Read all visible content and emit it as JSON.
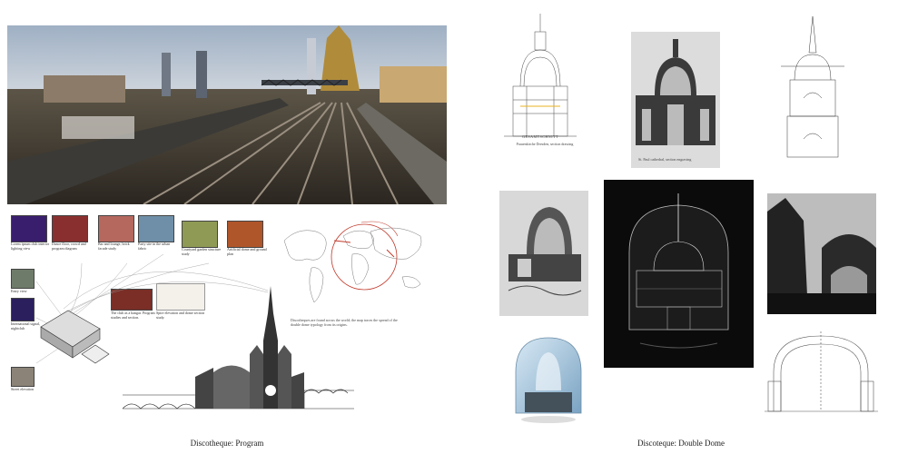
{
  "panels": {
    "left": {
      "caption": "Discotheque: Program"
    },
    "right": {
      "caption": "Discoteque: Double Dome"
    }
  },
  "left_thumbs": [
    {
      "caption": "Lorem ipsum club interior lighting view"
    },
    {
      "caption": "Dance floor, crowd and program diagram"
    },
    {
      "caption": "Bar and lounge, brick facade study"
    },
    {
      "caption": "Party site in the urban fabric"
    },
    {
      "caption": "Courtyard garden structure study"
    },
    {
      "caption": "Artificial dome and ground plan"
    }
  ],
  "side_thumbs": [
    {
      "caption": "Entry view"
    },
    {
      "caption": "International signal, nightclub"
    },
    {
      "caption": "Street elevation"
    }
  ],
  "row2_thumbs": [
    {
      "caption": "The club as a hangar. Program studies and section."
    },
    {
      "caption": "Spire elevation and dome section study."
    }
  ],
  "map_note": "Discotheques are found across the world; the map traces the spread of the double dome typology from its origins.",
  "drawing_label": "GESAMTSCHNITT",
  "drawing_note": "Frauenkirche Dresden, section drawing",
  "photo_note": "St. Paul cathedral, section engraving",
  "colors": {
    "accent": "#c0392b",
    "dark": "#111111"
  }
}
